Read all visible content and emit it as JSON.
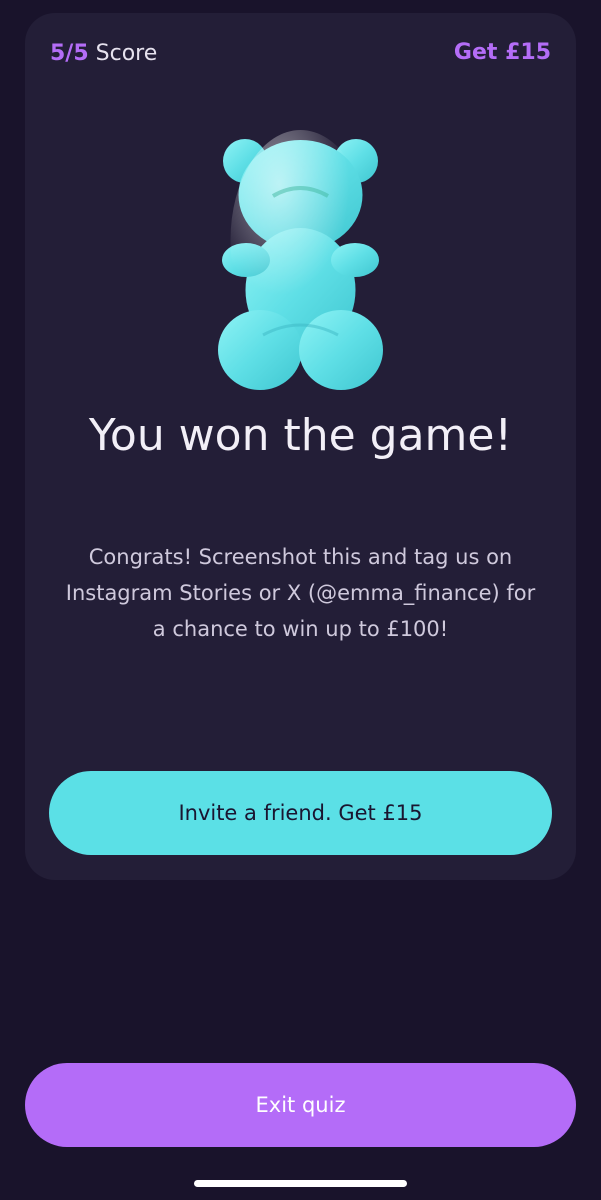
{
  "header": {
    "score_value": "5/5",
    "score_label": "Score",
    "get_link": "Get £15"
  },
  "result": {
    "illustration_icon": "gummy-bear-icon",
    "title": "You won the game!",
    "message": "Congrats! Screenshot this and tag us on Instagram Stories or X (@emma_finance) for a chance to win up to £100!"
  },
  "buttons": {
    "invite_label": "Invite a friend. Get £15",
    "exit_label": "Exit quiz"
  },
  "colors": {
    "background": "#19132b",
    "card": "#231e37",
    "accent_purple": "#b46cf8",
    "accent_cyan": "#5be0e6"
  }
}
